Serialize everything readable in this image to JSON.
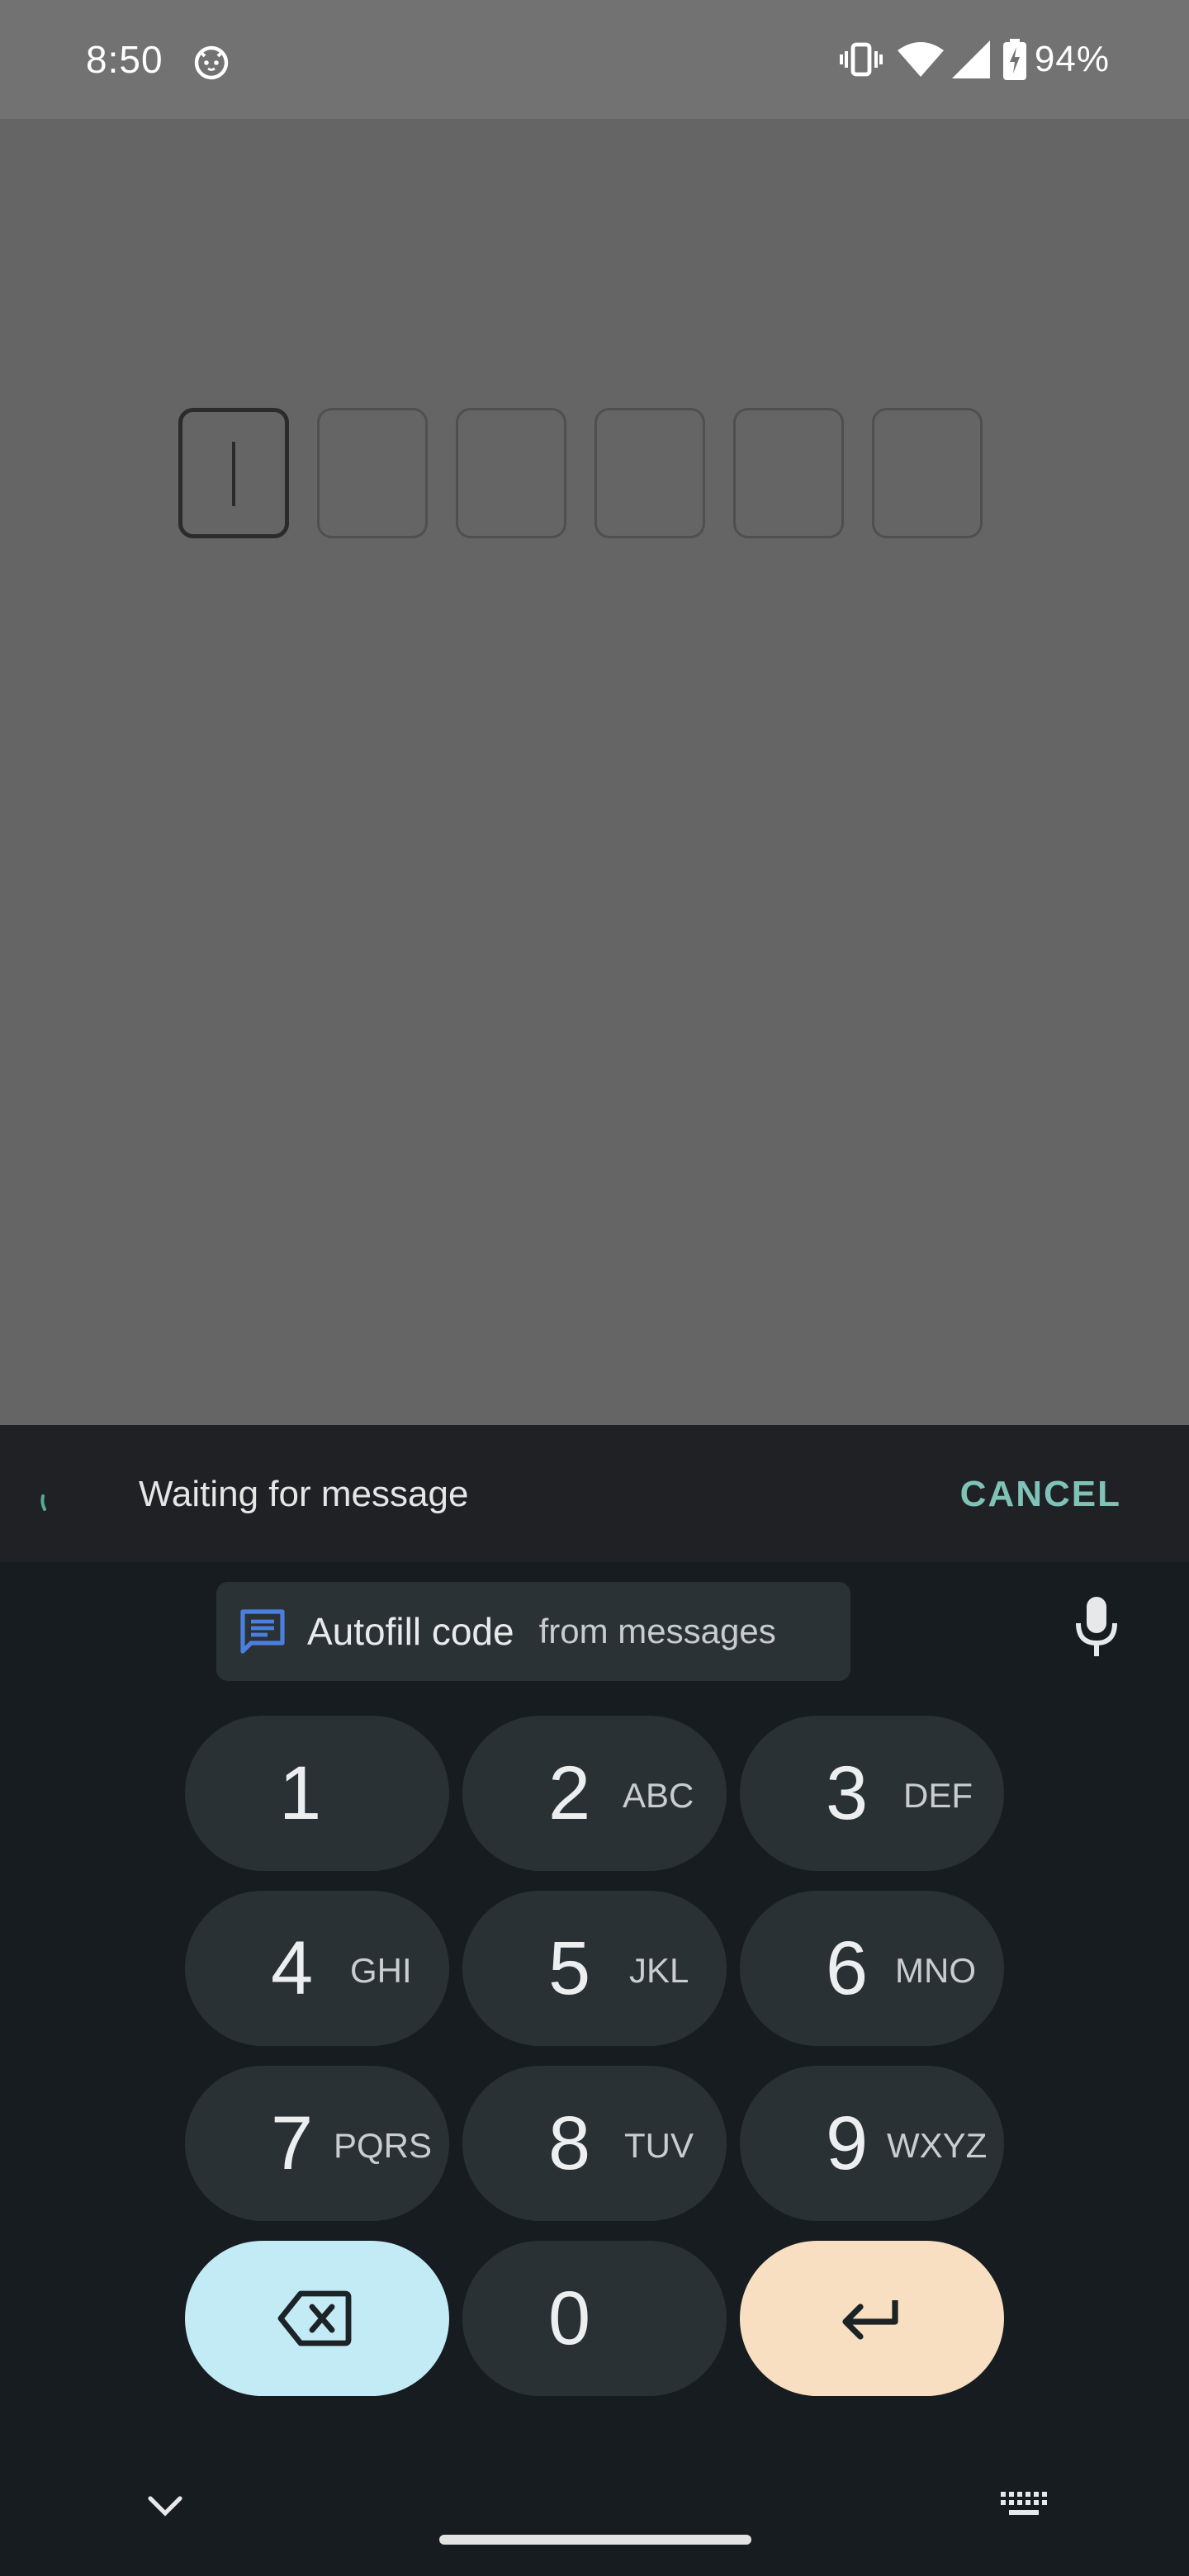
{
  "status_bar": {
    "time": "8:50",
    "app_icon": "cat-notification-icon",
    "icons": [
      "vibrate-icon",
      "wifi-icon",
      "signal-icon",
      "battery-charging-icon"
    ],
    "battery": "94%"
  },
  "otp": {
    "boxes": [
      "",
      "",
      "",
      "",
      "",
      ""
    ],
    "active_index": 0
  },
  "sms_wait": {
    "text": "Waiting for message",
    "cancel_label": "CANCEL",
    "accent_color": "#7ec2b8"
  },
  "keyboard": {
    "autofill": {
      "label": "Autofill code",
      "sub": "from messages",
      "icon": "message-icon",
      "icon_color": "#4a7fe0"
    },
    "mic_icon": "mic-icon",
    "keys": {
      "k1": {
        "digit": "1",
        "letters": ""
      },
      "k2": {
        "digit": "2",
        "letters": "ABC"
      },
      "k3": {
        "digit": "3",
        "letters": "DEF"
      },
      "k4": {
        "digit": "4",
        "letters": "GHI"
      },
      "k5": {
        "digit": "5",
        "letters": "JKL"
      },
      "k6": {
        "digit": "6",
        "letters": "MNO"
      },
      "k7": {
        "digit": "7",
        "letters": "PQRS"
      },
      "k8": {
        "digit": "8",
        "letters": "TUV"
      },
      "k9": {
        "digit": "9",
        "letters": "WXYZ"
      },
      "k0": {
        "digit": "0",
        "letters": ""
      }
    },
    "backspace_icon": "backspace-icon",
    "enter_icon": "enter-icon",
    "hide_icon": "chevron-down-icon",
    "switch_icon": "keyboard-icon",
    "colors": {
      "backspace_key": "#c2ebf5",
      "enter_key": "#f8dfc2",
      "digit_key": "#293134"
    }
  }
}
